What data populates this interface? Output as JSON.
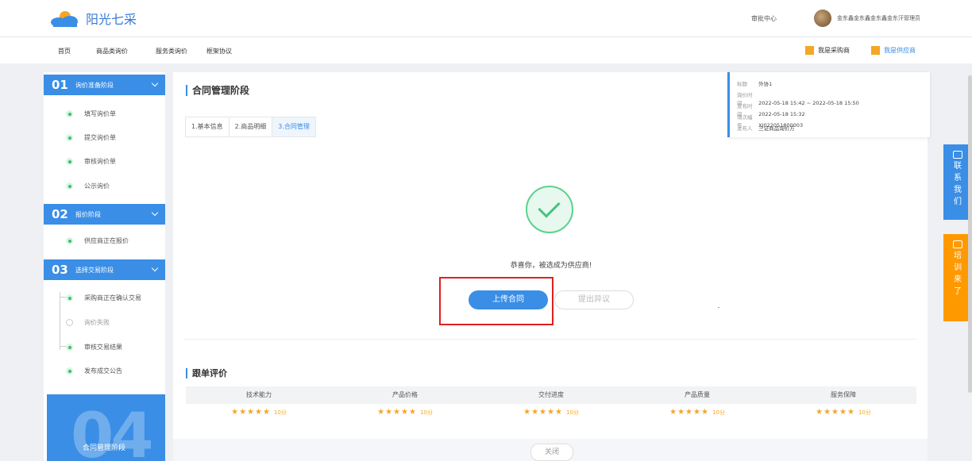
{
  "header": {
    "logo_text": "阳光七采",
    "approval_center": "审批中心",
    "user_name": "金东鑫金东鑫金东鑫金东汗管理员"
  },
  "nav": {
    "items": [
      "首页",
      "商品类询价",
      "服务类询价",
      "框架协议"
    ],
    "role_buyer": "我是采购商",
    "role_supplier": "我是供应商"
  },
  "sidebar": {
    "stage1": {
      "num": "01",
      "title": "询价准备阶段",
      "steps": [
        "填写询价单",
        "提交询价单",
        "审核询价单",
        "公示询价"
      ]
    },
    "stage2": {
      "num": "02",
      "title": "报价阶段",
      "steps": [
        "供应商正在报价"
      ]
    },
    "stage3": {
      "num": "03",
      "title": "选择交易阶段",
      "steps": [
        "采购商正在确认交易",
        "询价失败",
        "审核交易结果",
        "发布成交公告"
      ]
    },
    "card": {
      "num": "04",
      "label": "合同管理阶段"
    }
  },
  "main": {
    "title": "合同管理阶段",
    "tabs": [
      "1.基本信息",
      "2.商品明细",
      "3.合同管理"
    ],
    "info": {
      "title_k": "标题",
      "title_v": "外协1",
      "time_k": "询价时间",
      "time_v": "2022-05-18 15:42 ~ 2022-05-18 15:50",
      "publish_k": "发布时间",
      "publish_v": "2022-05-18 15:32",
      "code_k": "场次编号",
      "code_v": "XJ022051800003",
      "publisher_k": "发布人",
      "publisher_v": "三证商品询价方"
    },
    "congrats": "恭喜你，被选成为供应商!",
    "upload_button": "上传合同",
    "objection_button": "提出异议",
    "rating_title": "跟单评价",
    "rating_headers": [
      "技术能力",
      "产品价格",
      "交付进度",
      "产品质量",
      "服务保障"
    ],
    "rating_stars": "★★★★★",
    "rating_score": "10分",
    "close_button": "关闭"
  },
  "floats": {
    "contact": [
      "联",
      "系",
      "我",
      "们"
    ],
    "training": [
      "培",
      "训",
      "来",
      "了"
    ]
  },
  "colors": {
    "primary": "#3a8ee6",
    "success": "#48c37d",
    "star": "#f5a623",
    "orange": "#ff9900",
    "highlight": "#e02020"
  }
}
